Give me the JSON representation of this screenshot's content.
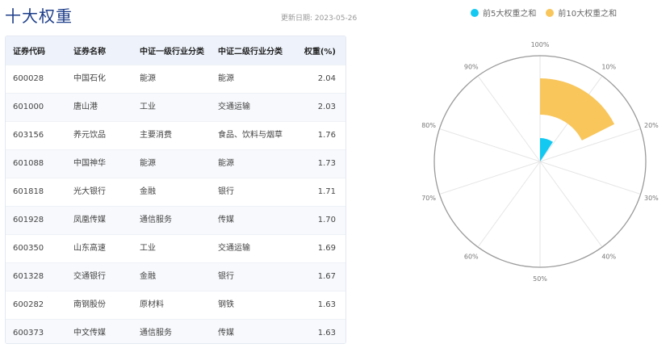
{
  "header": {
    "title": "十大权重",
    "update_date": "更新日期: 2023-05-26"
  },
  "table": {
    "columns": [
      "证券代码",
      "证券名称",
      "中证一级行业分类",
      "中证二级行业分类",
      "权重(%)"
    ],
    "rows": [
      [
        "600028",
        "中国石化",
        "能源",
        "能源",
        "2.04"
      ],
      [
        "601000",
        "唐山港",
        "工业",
        "交通运输",
        "2.03"
      ],
      [
        "603156",
        "养元饮品",
        "主要消费",
        "食品、饮料与烟草",
        "1.76"
      ],
      [
        "601088",
        "中国神华",
        "能源",
        "能源",
        "1.73"
      ],
      [
        "601818",
        "光大银行",
        "金融",
        "银行",
        "1.71"
      ],
      [
        "601928",
        "凤凰传媒",
        "通信服务",
        "传媒",
        "1.70"
      ],
      [
        "600350",
        "山东高速",
        "工业",
        "交通运输",
        "1.69"
      ],
      [
        "601328",
        "交通银行",
        "金融",
        "银行",
        "1.67"
      ],
      [
        "600282",
        "南钢股份",
        "原材料",
        "钢铁",
        "1.63"
      ],
      [
        "600373",
        "中文传媒",
        "通信服务",
        "传媒",
        "1.63"
      ]
    ]
  },
  "chart_data": {
    "type": "polar-bar",
    "series": [
      {
        "name": "前5大权重之和",
        "value": 9.27,
        "color": "#13c9f1"
      },
      {
        "name": "前10大权重之和",
        "value": 17.59,
        "color": "#f8c65b"
      }
    ],
    "angle_axis": {
      "min": 0,
      "max": 100,
      "ticks": [
        "100%",
        "10%",
        "20%",
        "30%",
        "40%",
        "50%",
        "60%",
        "70%",
        "80%",
        "90%"
      ]
    },
    "legend_position": "top-center",
    "grid": true
  }
}
